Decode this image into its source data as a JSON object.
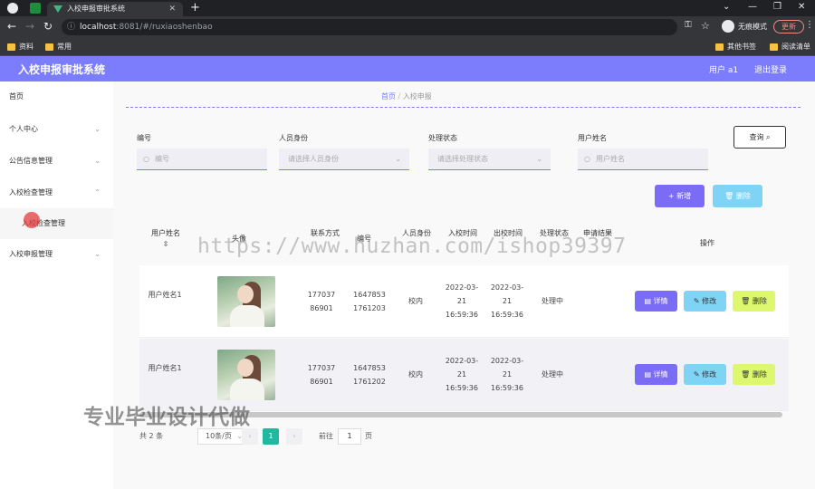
{
  "browser": {
    "tab_title": "入校申报审批系统",
    "url_host": "localhost",
    "url_path": ":8081/#/ruxiaoshenbao",
    "incognito_label": "无痕模式",
    "update_label": "更新",
    "bookmarks": [
      "资料",
      "常用"
    ],
    "bookmarks_right": [
      "其他书签",
      "阅读清单"
    ]
  },
  "header": {
    "title": "入校申报审批系统",
    "user": "用户 a1",
    "logout": "退出登录"
  },
  "sidebar": {
    "items": [
      {
        "label": "首页"
      },
      {
        "label": "个人中心"
      },
      {
        "label": "公告信息管理"
      },
      {
        "label": "入校检查管理"
      },
      {
        "label": "入校检查管理"
      },
      {
        "label": "入校申报管理"
      }
    ]
  },
  "breadcrumb": {
    "home": "首页",
    "current": "入校申报"
  },
  "filters": {
    "fields": [
      {
        "label": "编号",
        "placeholder": "编号"
      },
      {
        "label": "人员身份",
        "placeholder": "请选择人员身份"
      },
      {
        "label": "处理状态",
        "placeholder": "请选择处理状态"
      },
      {
        "label": "用户姓名",
        "placeholder": "用户姓名"
      }
    ],
    "query_label": "查询"
  },
  "actions": {
    "add_label": "新增",
    "delete_label": "删除"
  },
  "table": {
    "headers": [
      "用户姓名",
      "头像",
      "联系方式",
      "编号",
      "人员身份",
      "入校时间",
      "出校时间",
      "处理状态",
      "申请结果",
      "操作"
    ],
    "rows": [
      {
        "name": "用户姓名1",
        "phone": "17703786901",
        "number": "16478531761203",
        "identity": "校内",
        "entry_time": "2022-03-21 16:59:36",
        "exit_time": "2022-03-21 16:59:36",
        "status": "处理中",
        "result": ""
      },
      {
        "name": "用户姓名1",
        "phone": "17703786901",
        "number": "16478531761202",
        "identity": "校内",
        "entry_time": "2022-03-21 16:59:36",
        "exit_time": "2022-03-21 16:59:36",
        "status": "处理中",
        "result": ""
      }
    ],
    "row_buttons": {
      "detail": "详情",
      "edit": "修改",
      "delete": "删除"
    }
  },
  "pagination": {
    "total": "共 2 条",
    "page_size": "10条/页",
    "current_page": "1",
    "goto_label": "前往",
    "goto_value": "1",
    "page_suffix": "页"
  },
  "watermarks": {
    "url": "https://www.huzhan.com/ishop39397",
    "text": "专业毕业设计代做"
  },
  "colors": {
    "accent": "#7b7dfc",
    "primary_button": "#7b6cf6",
    "info_button": "#7fd3f5",
    "warning_button": "#ddf76e",
    "pager_active": "#20b9a0"
  }
}
